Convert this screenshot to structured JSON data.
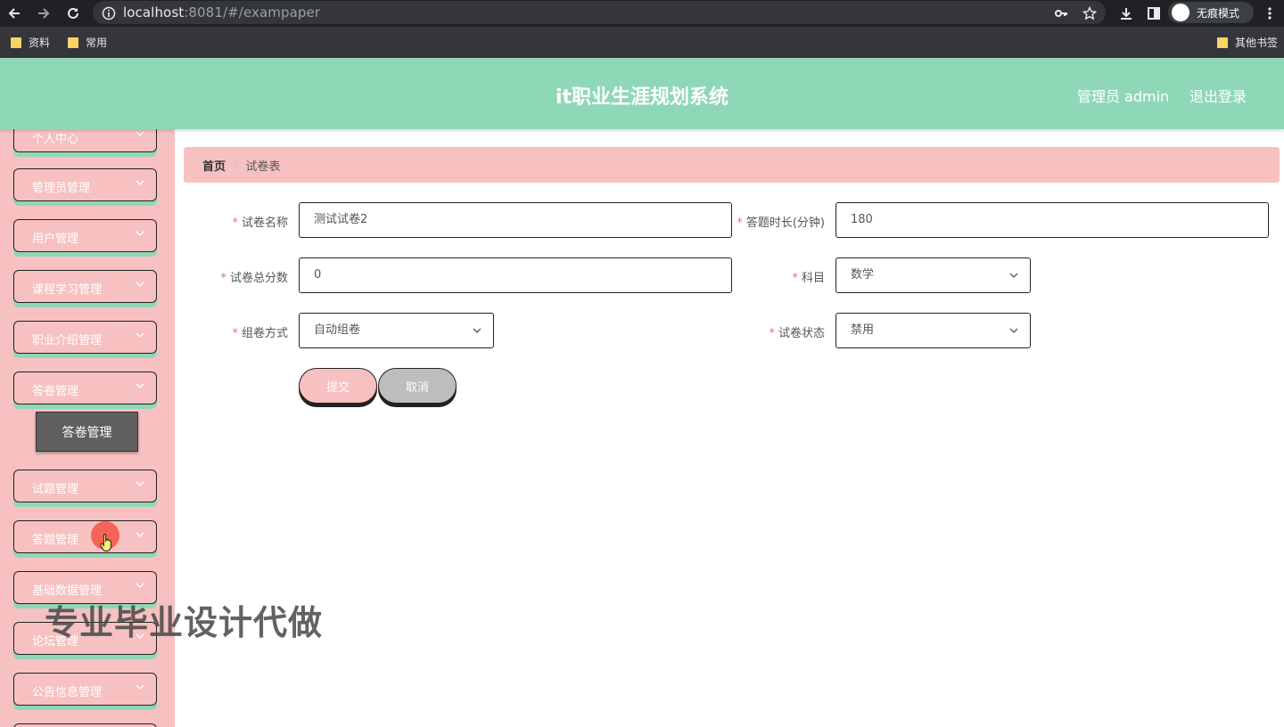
{
  "browser": {
    "url_host": "localhost",
    "url_rest": ":8081/#/exampaper",
    "incognito_label": "无痕模式",
    "bookmarks": [
      "资料",
      "常用"
    ],
    "other_bookmarks": "其他书签"
  },
  "header": {
    "title": "it职业生涯规划系统",
    "user": "管理员 admin",
    "logout": "退出登录"
  },
  "sidebar": {
    "items": [
      {
        "label": "个人中心"
      },
      {
        "label": "管理员管理"
      },
      {
        "label": "用户管理"
      },
      {
        "label": "课程学习管理"
      },
      {
        "label": "职业介绍管理"
      },
      {
        "label": "答卷管理"
      },
      {
        "label": "试题管理"
      },
      {
        "label": "答题管理"
      },
      {
        "label": "基础数据管理"
      },
      {
        "label": "论坛管理"
      },
      {
        "label": "公告信息管理"
      }
    ],
    "submenu_label": "答卷管理"
  },
  "breadcrumb": {
    "home": "首页",
    "separator": "/",
    "current": "试卷表"
  },
  "form": {
    "paper_name": {
      "label": "试卷名称",
      "value": "测试试卷2"
    },
    "duration": {
      "label": "答题时长(分钟)",
      "value": "180"
    },
    "total_score": {
      "label": "试卷总分数",
      "value": "0"
    },
    "subject": {
      "label": "科目",
      "value": "数学"
    },
    "compose_method": {
      "label": "组卷方式",
      "value": "自动组卷"
    },
    "status": {
      "label": "试卷状态",
      "value": "禁用"
    },
    "required_mark": "*",
    "submit_label": "提交",
    "cancel_label": "取消"
  },
  "watermark": "专业毕业设计代做",
  "colors": {
    "header_bg": "#8fd8b7",
    "sidebar_bg": "#f7c1c1",
    "required": "#f56c6c"
  }
}
